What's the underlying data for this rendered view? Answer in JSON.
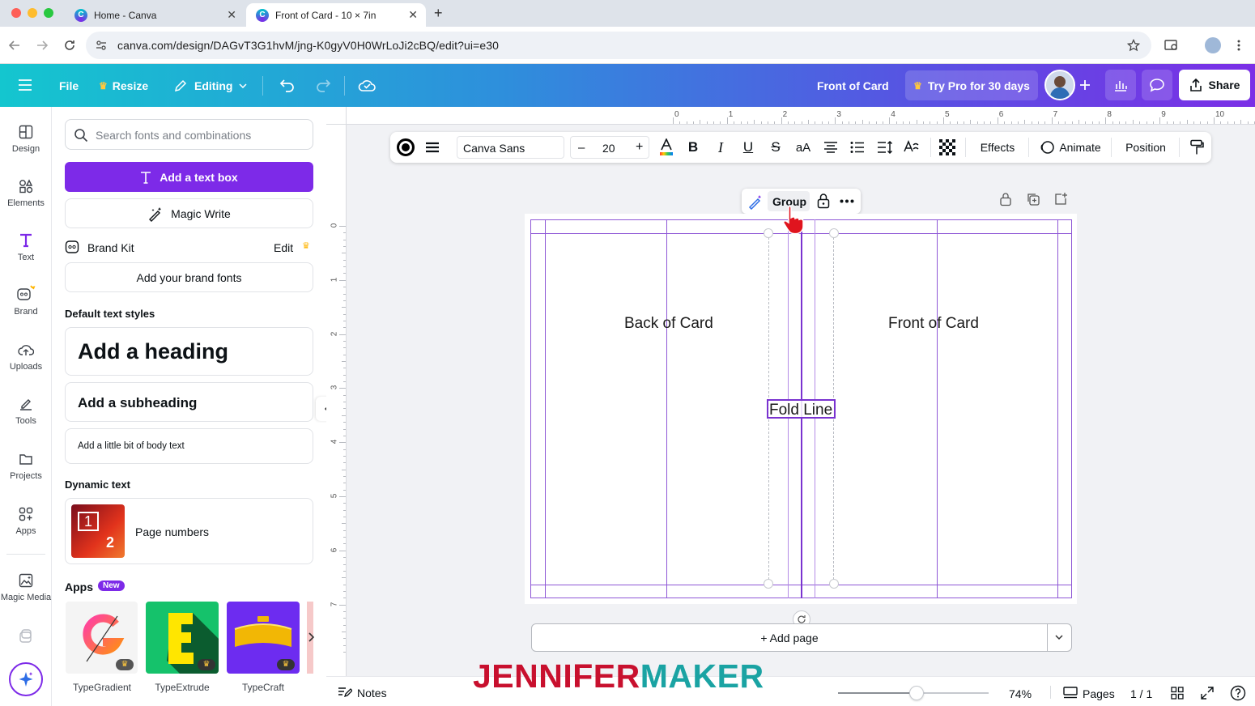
{
  "browser": {
    "tabs": [
      {
        "title": "Home - Canva"
      },
      {
        "title": "Front of Card - 10 × 7in"
      }
    ],
    "url": "canva.com/design/DAGvT3G1hvM/jng-K0gyV0H0WrLoJi2cBQ/edit?ui=e30"
  },
  "header": {
    "file": "File",
    "resize": "Resize",
    "editing": "Editing",
    "design_title": "Front of Card",
    "try_pro": "Try Pro for 30 days",
    "share": "Share"
  },
  "rail": {
    "items": [
      {
        "label": "Design",
        "icon": "design-icon"
      },
      {
        "label": "Elements",
        "icon": "elements-icon"
      },
      {
        "label": "Text",
        "icon": "text-icon"
      },
      {
        "label": "Brand",
        "icon": "brand-icon"
      },
      {
        "label": "Uploads",
        "icon": "uploads-icon"
      },
      {
        "label": "Tools",
        "icon": "tools-icon"
      },
      {
        "label": "Projects",
        "icon": "projects-icon"
      },
      {
        "label": "Apps",
        "icon": "apps-icon"
      },
      {
        "label": "Magic Media",
        "icon": "magic-media-icon"
      }
    ]
  },
  "panel": {
    "search_placeholder": "Search fonts and combinations",
    "add_text_box": "Add a text box",
    "magic_write": "Magic Write",
    "brand_kit": "Brand Kit",
    "brand_edit": "Edit",
    "add_brand_fonts": "Add your brand fonts",
    "default_styles": "Default text styles",
    "heading": "Add a heading",
    "subheading": "Add a subheading",
    "body": "Add a little bit of body text",
    "dynamic_text": "Dynamic text",
    "page_numbers": "Page numbers",
    "page_numbers_thumb": [
      "1",
      "2"
    ],
    "apps": "Apps",
    "apps_badge": "New",
    "app_list": [
      {
        "name": "TypeGradient"
      },
      {
        "name": "TypeExtrude"
      },
      {
        "name": "TypeCraft"
      }
    ]
  },
  "ruler": {
    "top": [
      "0",
      "1",
      "2",
      "3",
      "4",
      "5",
      "6",
      "7",
      "8",
      "9",
      "10"
    ],
    "left": [
      "0",
      "1",
      "2",
      "3",
      "4",
      "5",
      "6",
      "7"
    ]
  },
  "toolbar": {
    "font": "Canva Sans",
    "size": "20",
    "minus": "–",
    "plus": "+",
    "effects": "Effects",
    "animate": "Animate",
    "position": "Position"
  },
  "floating": {
    "group": "Group"
  },
  "canvas": {
    "back_label": "Back of Card",
    "front_label": "Front of Card",
    "fold_label": "Fold Line",
    "guide_color": "#8e57d6"
  },
  "add_page": "+ Add page",
  "footer": {
    "notes": "Notes",
    "zoom": "74%",
    "zoom_level": 0.74,
    "pages": "Pages",
    "page_count": "1 / 1"
  },
  "watermark": {
    "part1": "JENNIFER",
    "part2": "MAKER",
    "color1": "#c8102e",
    "color2": "#1aa3a3"
  },
  "colors": {
    "accent": "#7d2ae8",
    "teal": "#14c6cf"
  }
}
